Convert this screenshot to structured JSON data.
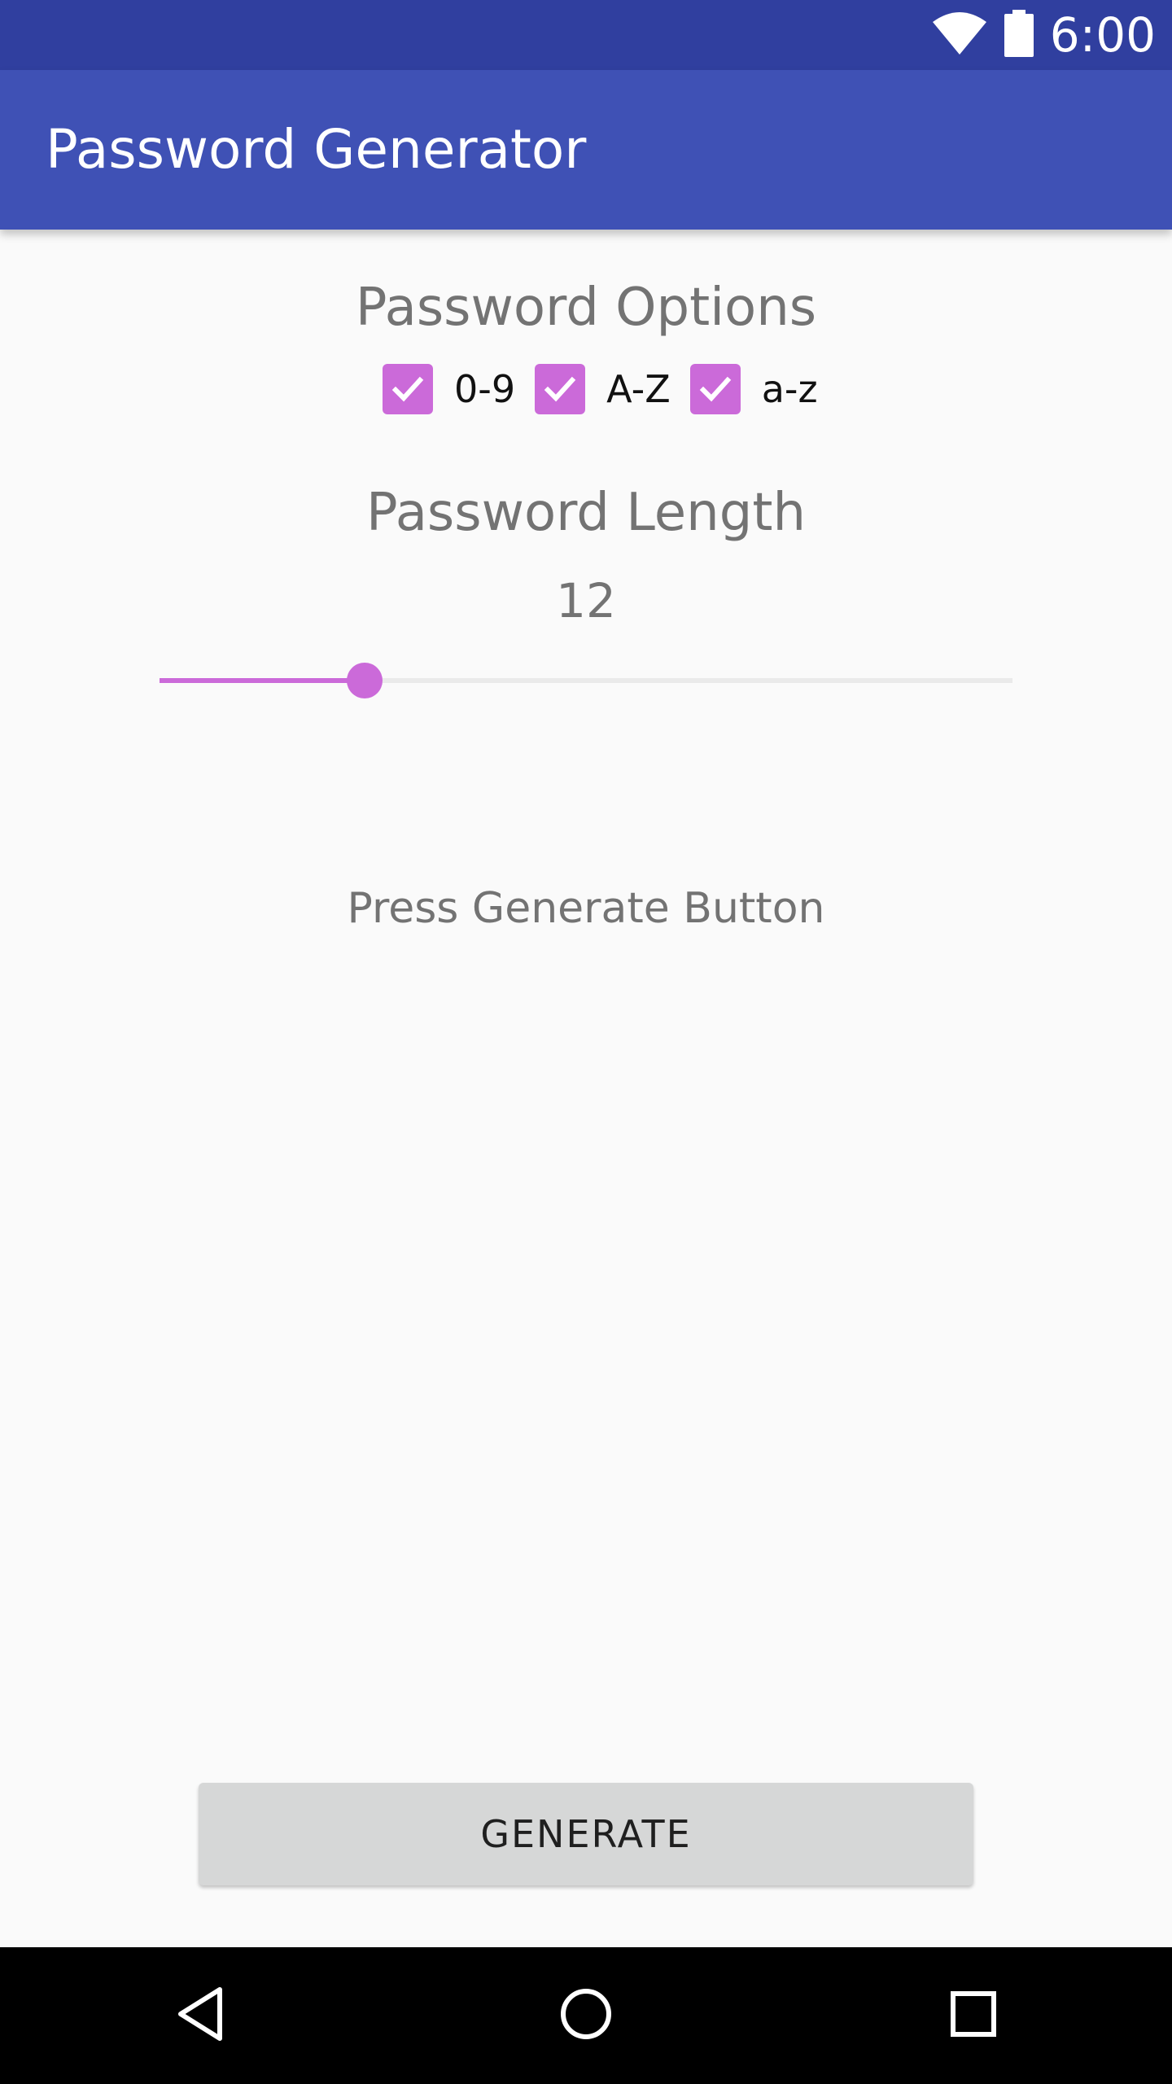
{
  "status_bar": {
    "time": "6:00",
    "icons": [
      "wifi-icon",
      "battery-icon"
    ]
  },
  "app_bar": {
    "title": "Password Generator"
  },
  "options": {
    "title": "Password Options",
    "checkboxes": [
      {
        "label": "0-9",
        "checked": true
      },
      {
        "label": "A-Z",
        "checked": true
      },
      {
        "label": "a-z",
        "checked": true
      }
    ]
  },
  "length": {
    "title": "Password Length",
    "value": "12",
    "slider_fraction": 0.24
  },
  "result": {
    "text": "Press Generate Button"
  },
  "generate_button": {
    "label": "GENERATE"
  },
  "nav_bar": {
    "icons": [
      "back-icon",
      "home-icon",
      "recent-apps-icon"
    ]
  },
  "colors": {
    "status_bar": "#303f9f",
    "app_bar": "#3f51b5",
    "accent": "#cb6ad9",
    "button_bg": "#d6d7d7",
    "secondary_text": "#737373"
  }
}
